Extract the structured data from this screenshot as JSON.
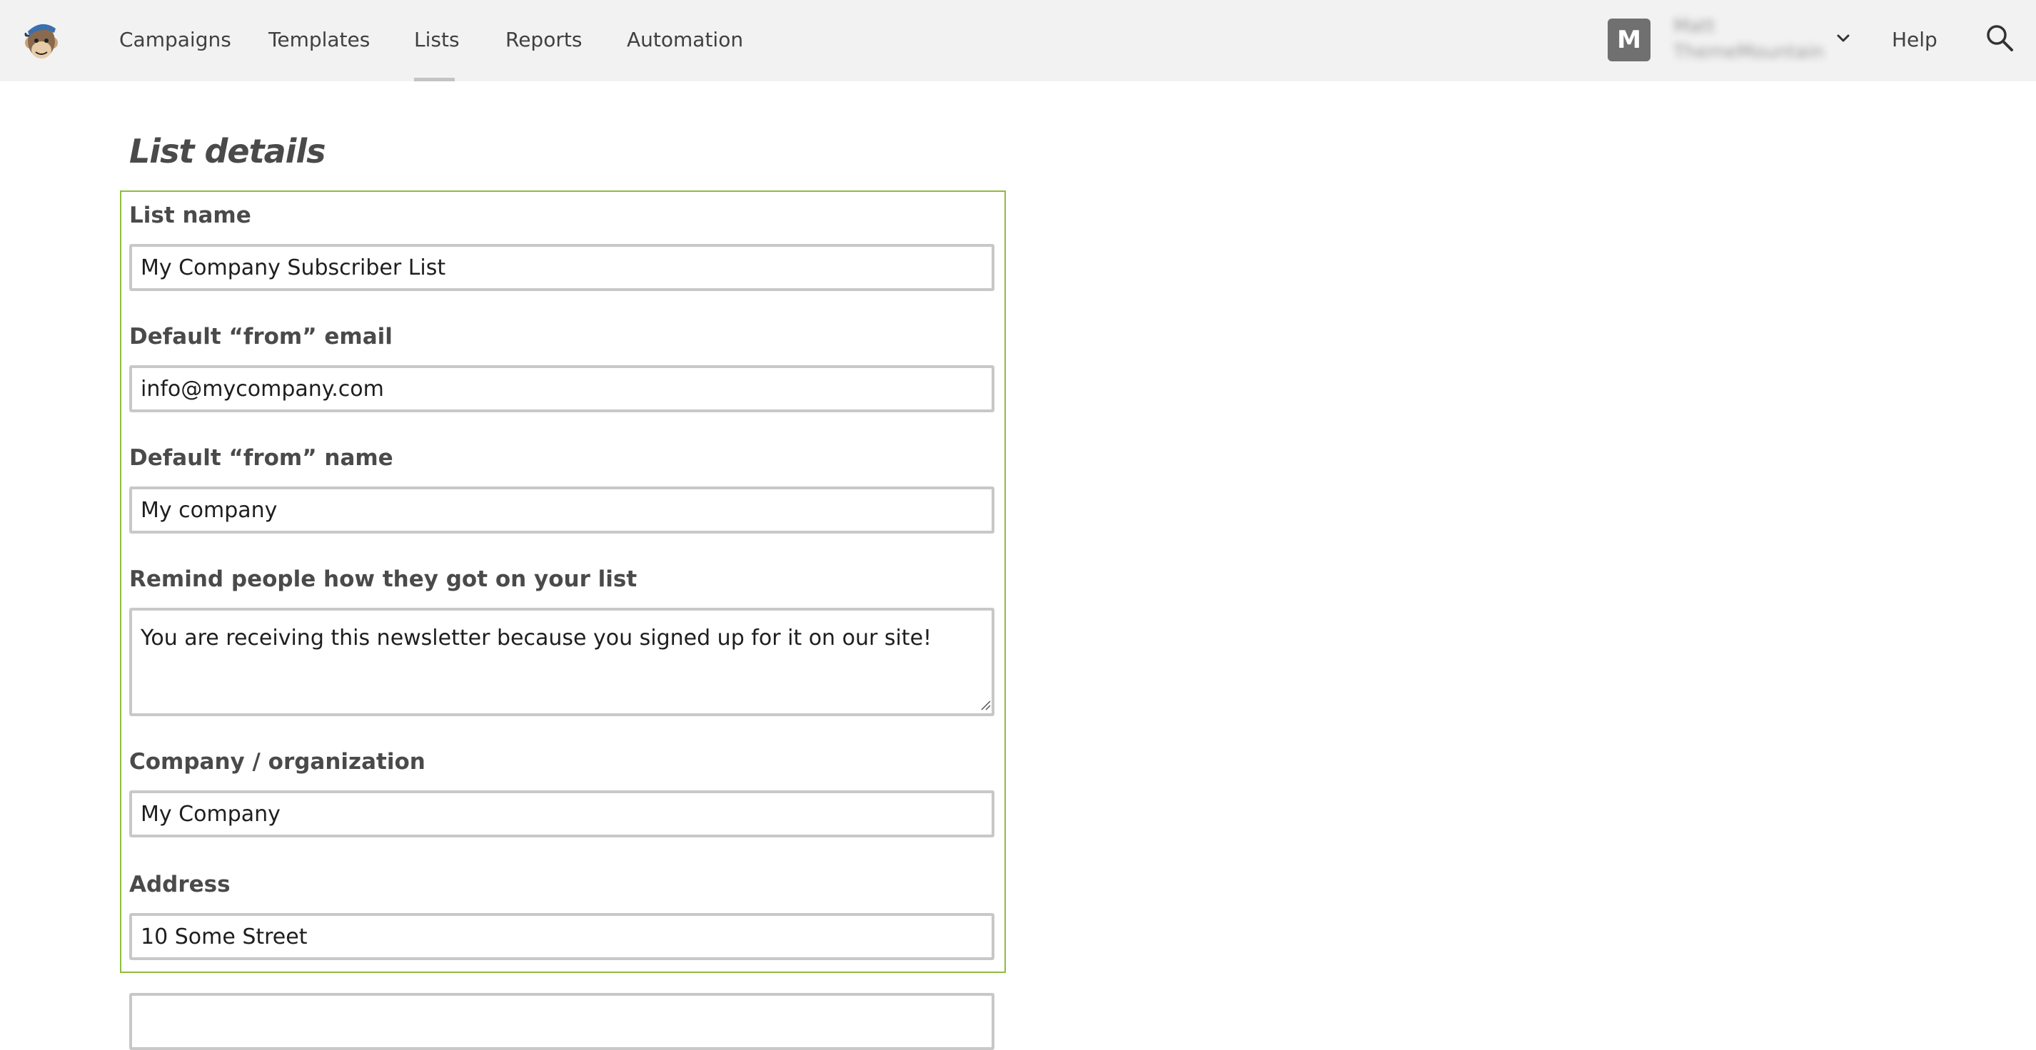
{
  "nav": {
    "items": [
      {
        "label": "Campaigns"
      },
      {
        "label": "Templates"
      },
      {
        "label": "Lists",
        "active": true
      },
      {
        "label": "Reports"
      },
      {
        "label": "Automation"
      }
    ]
  },
  "account": {
    "avatar_letter": "M",
    "name": "Matt",
    "org": "ThemeMountain"
  },
  "header": {
    "help_label": "Help"
  },
  "page": {
    "title": "List details"
  },
  "form": {
    "fields": [
      {
        "label": "List name",
        "value": "My Company Subscriber List"
      },
      {
        "label": "Default “from” email",
        "value": "info@mycompany.com"
      },
      {
        "label": "Default “from” name",
        "value": "My company"
      },
      {
        "label": "Remind people how they got on your list",
        "value": "You are receiving this newsletter because you signed up for it on our site!"
      },
      {
        "label": "Company / organization",
        "value": "My Company"
      },
      {
        "label": "Address",
        "value": "10 Some Street"
      }
    ],
    "border_color": "#8fbc3b"
  },
  "icons": {
    "logo": "mailchimp-monkey-logo",
    "chevron": "chevron-down-icon",
    "search": "search-icon"
  }
}
